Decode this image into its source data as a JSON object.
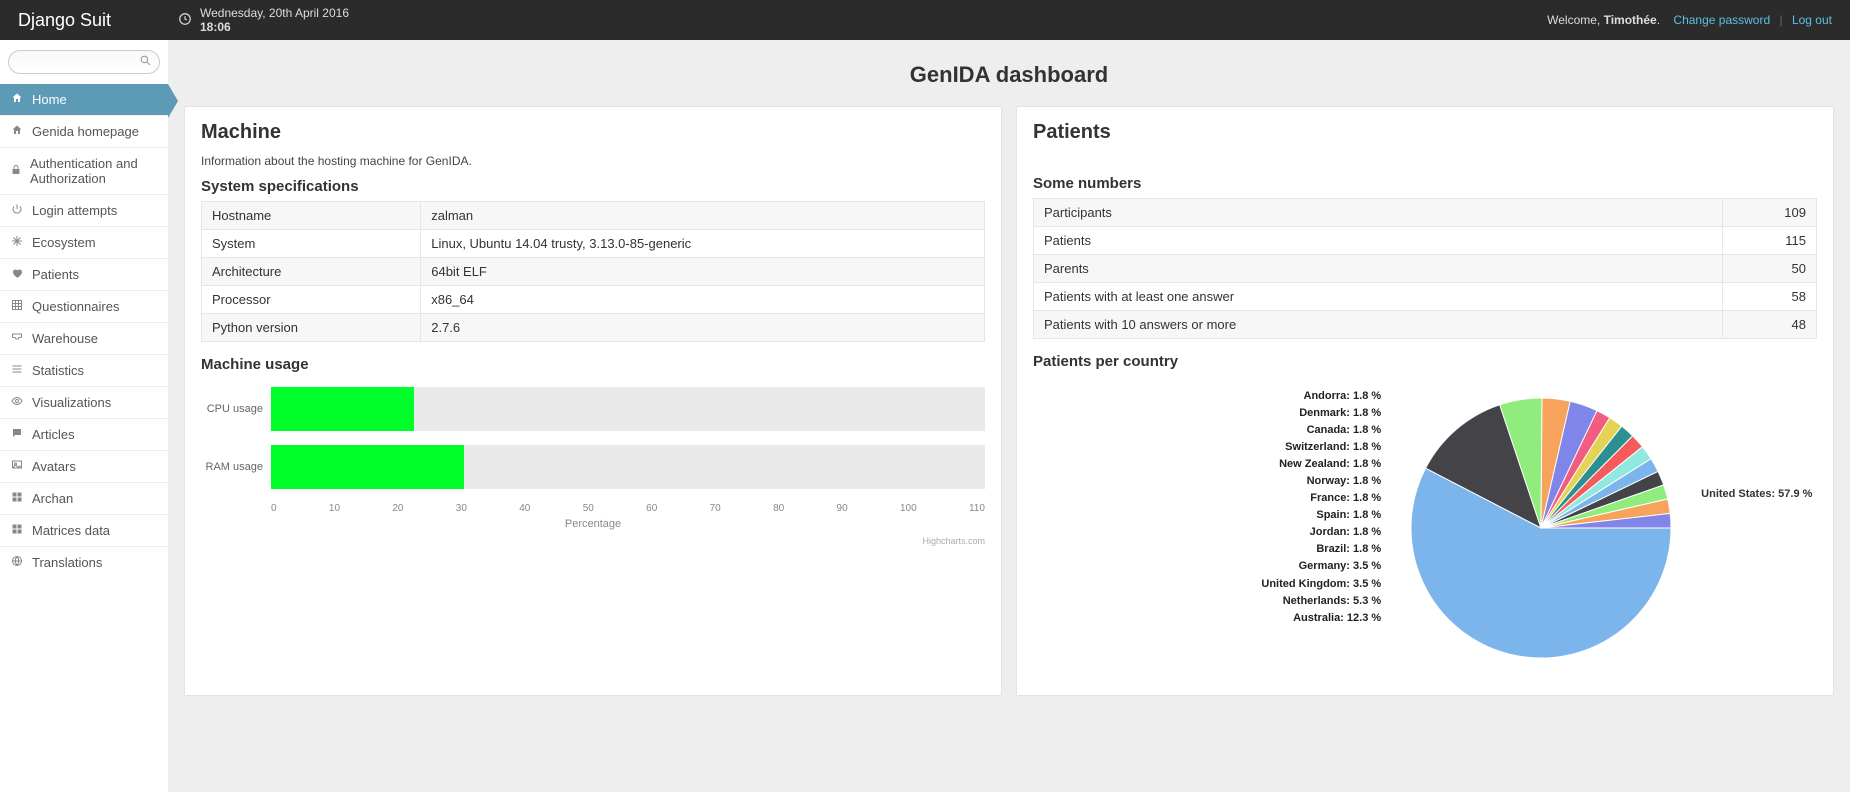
{
  "header": {
    "brand": "Django Suit",
    "date": "Wednesday, 20th April 2016",
    "time": "18:06",
    "welcome_prefix": "Welcome, ",
    "username": "Timothée",
    "change_password": "Change password",
    "logout": "Log out"
  },
  "search": {
    "placeholder": ""
  },
  "nav": {
    "items": [
      {
        "label": "Home",
        "icon": "home",
        "active": true
      },
      {
        "label": "Genida homepage",
        "icon": "home"
      },
      {
        "label": "Authentication and Authorization",
        "icon": "lock"
      },
      {
        "label": "Login attempts",
        "icon": "power"
      },
      {
        "label": "Ecosystem",
        "icon": "snow"
      },
      {
        "label": "Patients",
        "icon": "heart"
      },
      {
        "label": "Questionnaires",
        "icon": "grid"
      },
      {
        "label": "Warehouse",
        "icon": "tray"
      },
      {
        "label": "Statistics",
        "icon": "bars"
      },
      {
        "label": "Visualizations",
        "icon": "eye"
      },
      {
        "label": "Articles",
        "icon": "chat"
      },
      {
        "label": "Avatars",
        "icon": "image"
      },
      {
        "label": "Archan",
        "icon": "grid4"
      },
      {
        "label": "Matrices data",
        "icon": "grid4"
      },
      {
        "label": "Translations",
        "icon": "globe"
      }
    ]
  },
  "page": {
    "title": "GenIDA dashboard"
  },
  "machine": {
    "heading": "Machine",
    "note": "Information about the hosting machine for GenIDA.",
    "specs_heading": "System specifications",
    "specs": [
      {
        "k": "Hostname",
        "v": "zalman"
      },
      {
        "k": "System",
        "v": "Linux, Ubuntu 14.04 trusty, 3.13.0-85-generic"
      },
      {
        "k": "Architecture",
        "v": "64bit ELF"
      },
      {
        "k": "Processor",
        "v": "x86_64"
      },
      {
        "k": "Python version",
        "v": "2.7.6"
      }
    ],
    "usage_heading": "Machine usage",
    "axis_label": "Percentage",
    "credit": "Highcharts.com"
  },
  "patients": {
    "heading": "Patients",
    "numbers_heading": "Some numbers",
    "rows": [
      {
        "k": "Participants",
        "v": "109"
      },
      {
        "k": "Patients",
        "v": "115"
      },
      {
        "k": "Parents",
        "v": "50"
      },
      {
        "k": "Patients with at least one answer",
        "v": "58"
      },
      {
        "k": "Patients with 10 answers or more",
        "v": "48"
      }
    ],
    "per_country_heading": "Patients per country"
  },
  "chart_data": [
    {
      "type": "bar",
      "orientation": "horizontal",
      "title": "Machine usage",
      "xlabel": "Percentage",
      "xlim": [
        0,
        110
      ],
      "xticks": [
        0,
        10,
        20,
        30,
        40,
        50,
        60,
        70,
        80,
        90,
        100,
        110
      ],
      "categories": [
        "CPU usage",
        "RAM usage"
      ],
      "values": [
        20,
        27
      ],
      "color": "#00ff2a"
    },
    {
      "type": "pie",
      "title": "Patients per country",
      "unit": "%",
      "series": [
        {
          "name": "United States",
          "value": 57.9,
          "color": "#7cb5ec"
        },
        {
          "name": "Australia",
          "value": 12.3,
          "color": "#434348"
        },
        {
          "name": "Netherlands",
          "value": 5.3,
          "color": "#90ed7d"
        },
        {
          "name": "United Kingdom",
          "value": 3.5,
          "color": "#f7a35c"
        },
        {
          "name": "Germany",
          "value": 3.5,
          "color": "#8085e9"
        },
        {
          "name": "Brazil",
          "value": 1.8,
          "color": "#f15c80"
        },
        {
          "name": "Jordan",
          "value": 1.8,
          "color": "#e4d354"
        },
        {
          "name": "Spain",
          "value": 1.8,
          "color": "#2b908f"
        },
        {
          "name": "France",
          "value": 1.8,
          "color": "#f45b5b"
        },
        {
          "name": "Norway",
          "value": 1.8,
          "color": "#91e8e1"
        },
        {
          "name": "New Zealand",
          "value": 1.8,
          "color": "#7cb5ec"
        },
        {
          "name": "Switzerland",
          "value": 1.8,
          "color": "#434348"
        },
        {
          "name": "Canada",
          "value": 1.8,
          "color": "#90ed7d"
        },
        {
          "name": "Denmark",
          "value": 1.8,
          "color": "#f7a35c"
        },
        {
          "name": "Andorra",
          "value": 1.8,
          "color": "#8085e9"
        }
      ]
    }
  ]
}
